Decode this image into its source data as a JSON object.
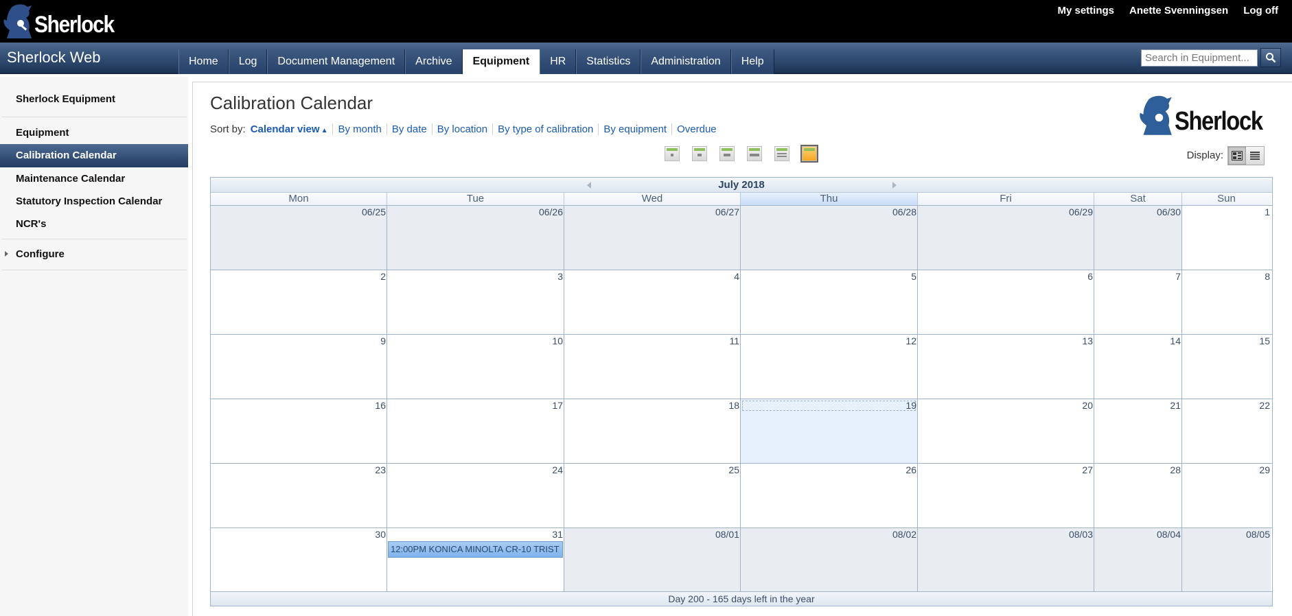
{
  "brand": {
    "logo_text": "Sherlock",
    "app_name": "Sherlock Web"
  },
  "top_links": [
    "My settings",
    "Anette Svenningsen",
    "Log off"
  ],
  "nav": {
    "tabs": [
      "Home",
      "Log",
      "Document Management",
      "Archive",
      "Equipment",
      "HR",
      "Statistics",
      "Administration",
      "Help"
    ],
    "active_tab": "Equipment",
    "search_placeholder": "Search in Equipment..."
  },
  "sidebar": {
    "heading": "Sherlock Equipment",
    "items": [
      "Equipment",
      "Calibration Calendar",
      "Maintenance Calendar",
      "Statutory Inspection Calendar",
      "NCR's"
    ],
    "active_item": "Calibration Calendar",
    "configure": "Configure"
  },
  "page": {
    "title": "Calibration Calendar",
    "sort_label": "Sort by:",
    "sort_options": [
      "Calendar view",
      "By month",
      "By date",
      "By location",
      "By type of calibration",
      "By equipment",
      "Overdue"
    ],
    "display_label": "Display:"
  },
  "calendar": {
    "month_title": "July 2018",
    "weekdays": [
      "Mon",
      "Tue",
      "Wed",
      "Thu",
      "Fri",
      "Sat",
      "Sun"
    ],
    "today_weekday_index": 3,
    "weeks": [
      [
        {
          "d": "06/25",
          "o": true
        },
        {
          "d": "06/26",
          "o": true
        },
        {
          "d": "06/27",
          "o": true
        },
        {
          "d": "06/28",
          "o": true
        },
        {
          "d": "06/29",
          "o": true
        },
        {
          "d": "06/30",
          "o": true
        },
        {
          "d": "1",
          "o": false
        }
      ],
      [
        {
          "d": "2"
        },
        {
          "d": "3"
        },
        {
          "d": "4"
        },
        {
          "d": "5"
        },
        {
          "d": "6"
        },
        {
          "d": "7"
        },
        {
          "d": "8"
        }
      ],
      [
        {
          "d": "9"
        },
        {
          "d": "10"
        },
        {
          "d": "11"
        },
        {
          "d": "12"
        },
        {
          "d": "13"
        },
        {
          "d": "14"
        },
        {
          "d": "15"
        }
      ],
      [
        {
          "d": "16"
        },
        {
          "d": "17"
        },
        {
          "d": "18"
        },
        {
          "d": "19",
          "today": true
        },
        {
          "d": "20"
        },
        {
          "d": "21"
        },
        {
          "d": "22"
        }
      ],
      [
        {
          "d": "23"
        },
        {
          "d": "24"
        },
        {
          "d": "25"
        },
        {
          "d": "26"
        },
        {
          "d": "27"
        },
        {
          "d": "28"
        },
        {
          "d": "29"
        }
      ],
      [
        {
          "d": "30"
        },
        {
          "d": "31",
          "event": "12:00PM KONICA MINOLTA CR-10 TRIST"
        },
        {
          "d": "08/01",
          "o": true
        },
        {
          "d": "08/02",
          "o": true
        },
        {
          "d": "08/03",
          "o": true
        },
        {
          "d": "08/04",
          "o": true
        },
        {
          "d": "08/05",
          "o": true
        }
      ]
    ],
    "footer": "Day 200 - 165 days left in the year"
  },
  "colors": {
    "nav_dark": "#223c62",
    "link_blue": "#1a5bb5",
    "event_blue": "#7fb2ea",
    "today_bg": "#e7f1fd",
    "other_month_bg": "#e9edf1"
  }
}
